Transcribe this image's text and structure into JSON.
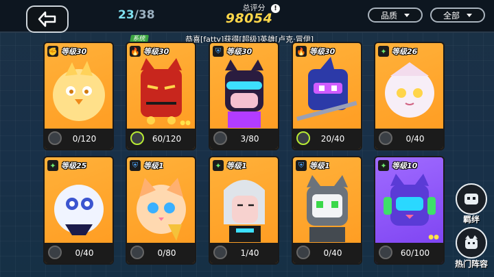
{
  "header": {
    "collected": "23",
    "separator": "/",
    "total": "38",
    "score_label": "总评分",
    "score_value": "98054",
    "info_symbol": "!",
    "filter_quality": "品质",
    "filter_all": "全部"
  },
  "ticker": {
    "tag": "系统",
    "message": "恭喜[fatty]获得[超级]英雄[卢克·冒伊]"
  },
  "cards": [
    {
      "level": "等级30",
      "progress": "0/120",
      "type_icon": "fist-icon",
      "bg": "orange"
    },
    {
      "level": "等级30",
      "progress": "60/120",
      "type_icon": "flame-icon",
      "bg": "orange"
    },
    {
      "level": "等级30",
      "progress": "3/80",
      "type_icon": "shield-icon",
      "bg": "orange"
    },
    {
      "level": "等级30",
      "progress": "20/40",
      "type_icon": "flame-icon",
      "bg": "orange"
    },
    {
      "level": "等级26",
      "progress": "0/40",
      "type_icon": "sparkle-icon",
      "bg": "orange"
    },
    {
      "level": "等级25",
      "progress": "0/40",
      "type_icon": "sparkle-icon",
      "bg": "orange"
    },
    {
      "level": "等级1",
      "progress": "0/80",
      "type_icon": "shield-icon",
      "bg": "orange"
    },
    {
      "level": "等级1",
      "progress": "1/40",
      "type_icon": "sparkle-icon",
      "bg": "orange"
    },
    {
      "level": "等级1",
      "progress": "0/40",
      "type_icon": "shield-icon",
      "bg": "orange"
    },
    {
      "level": "等级10",
      "progress": "60/100",
      "type_icon": "sparkle-icon",
      "bg": "purple"
    }
  ],
  "side": {
    "bond_label": "羁绊",
    "lineup_label": "热门阵容"
  }
}
